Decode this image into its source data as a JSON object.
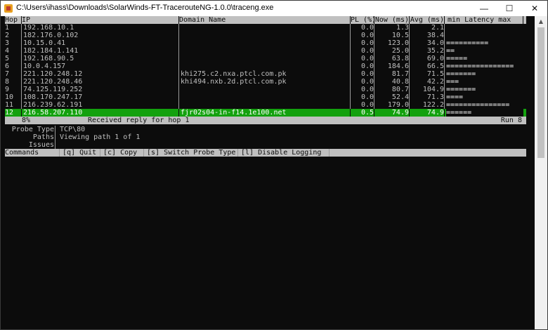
{
  "window": {
    "title": "C:\\Users\\ihass\\Downloads\\SolarWinds-FT-TracerouteNG-1.0.0\\traceng.exe",
    "minimize": "—",
    "maximize": "☐",
    "close": "✕"
  },
  "table": {
    "headers": {
      "hop": "Hop",
      "ip": "IP",
      "domain": "Domain Name",
      "pl": "PL (%)",
      "now": "Now (ms)",
      "avg": "Avg (ms)",
      "latency": "min  Latency  max"
    },
    "rows": [
      {
        "hop": "1",
        "ip": "192.168.10.1",
        "domain": "",
        "pl": "0.0",
        "now": "1.3",
        "avg": "2.1",
        "bar": ""
      },
      {
        "hop": "2",
        "ip": "182.176.0.102",
        "domain": "",
        "pl": "0.0",
        "now": "10.5",
        "avg": "38.4",
        "bar": ""
      },
      {
        "hop": "3",
        "ip": "10.15.0.41",
        "domain": "",
        "pl": "0.0",
        "now": "123.0",
        "avg": "34.0",
        "bar": "=========="
      },
      {
        "hop": "4",
        "ip": "182.184.1.141",
        "domain": "",
        "pl": "0.0",
        "now": "25.0",
        "avg": "35.2",
        "bar": "=="
      },
      {
        "hop": "5",
        "ip": "192.168.90.5",
        "domain": "",
        "pl": "0.0",
        "now": "63.8",
        "avg": "69.0",
        "bar": "====="
      },
      {
        "hop": "6",
        "ip": "10.0.4.157",
        "domain": "",
        "pl": "0.0",
        "now": "184.6",
        "avg": "66.5",
        "bar": "================"
      },
      {
        "hop": "7",
        "ip": "221.120.248.12",
        "domain": "khi275.c2.nxa.ptcl.com.pk",
        "pl": "0.0",
        "now": "81.7",
        "avg": "71.5",
        "bar": "======="
      },
      {
        "hop": "8",
        "ip": "221.120.248.46",
        "domain": "khi494.nxb.2d.ptcl.com.pk",
        "pl": "0.0",
        "now": "40.8",
        "avg": "42.2",
        "bar": "==="
      },
      {
        "hop": "9",
        "ip": "74.125.119.252",
        "domain": "",
        "pl": "0.0",
        "now": "80.7",
        "avg": "104.9",
        "bar": "======="
      },
      {
        "hop": "10",
        "ip": "108.170.247.17",
        "domain": "",
        "pl": "0.0",
        "now": "52.4",
        "avg": "71.3",
        "bar": "===="
      },
      {
        "hop": "11",
        "ip": "216.239.62.191",
        "domain": "",
        "pl": "0.0",
        "now": "179.0",
        "avg": "122.2",
        "bar": "==============="
      }
    ],
    "highlight": {
      "hop": "12",
      "ip": "216.58.207.110",
      "domain": "fjr02s04-in-f14.1e100.net",
      "pl": "0.5",
      "now": "74.9",
      "avg": "74.9",
      "bar": "======"
    }
  },
  "status": {
    "percent": "8%",
    "message": "Received reply for hop 1",
    "run": "Run 8"
  },
  "info": {
    "probe_type_label": "Probe Type",
    "probe_type_value": "TCP\\80",
    "paths_label": "Paths",
    "paths_value": "Viewing path 1 of 1",
    "issues_label": "Issues",
    "issues_value": ""
  },
  "commands": {
    "label": "Commands",
    "quit": "[q] Quit",
    "copy": "[c] Copy",
    "switch": "[s] Switch Probe Type",
    "logging": "[l] Disable Logging"
  }
}
